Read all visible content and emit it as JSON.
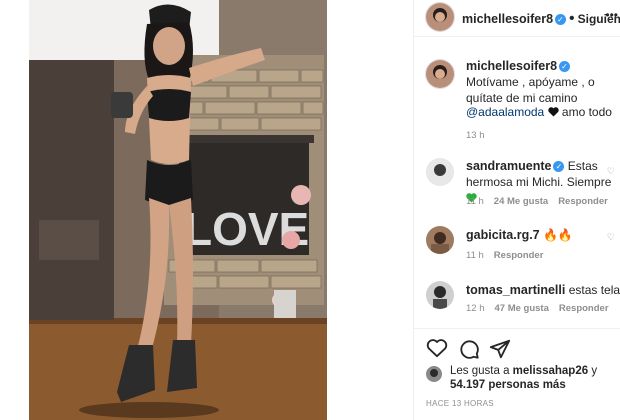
{
  "post": {
    "author": "michellesoifer8",
    "follow_status": "Siguiendo",
    "caption": "Motívame , apóyame , o quítate de mi camino",
    "caption_mention": "@adaalamoda",
    "caption_suffix": "amo todo",
    "caption_time": "13 h",
    "photo_sign": "LOVE"
  },
  "comments": [
    {
      "user": "sandramuente",
      "verified": true,
      "text": "Estas hermosa mi Michi. Siempre",
      "time": "11 h",
      "likes": "24 Me gusta",
      "reply": "Responder"
    },
    {
      "user": "gabicita.rg.7",
      "verified": false,
      "text": "🔥🔥",
      "time": "11 h",
      "likes": "",
      "reply": "Responder"
    },
    {
      "user": "tomas_martinelli",
      "verified": false,
      "text": "estas telasa",
      "time": "12 h",
      "likes": "47 Me gusta",
      "reply": "Responder"
    }
  ],
  "likes_summary": {
    "prefix": "Les gusta a",
    "user": "melissahap26",
    "connector": "y",
    "count": "54.197 personas más"
  },
  "posted_ago": "HACE 13 HORAS",
  "icons": [
    "heart-icon",
    "comment-icon",
    "share-icon",
    "verified-badge-icon",
    "more-options-icon"
  ],
  "colors": {
    "verified": "#3897f0",
    "muted": "#8e8e8e",
    "text": "#262626"
  }
}
